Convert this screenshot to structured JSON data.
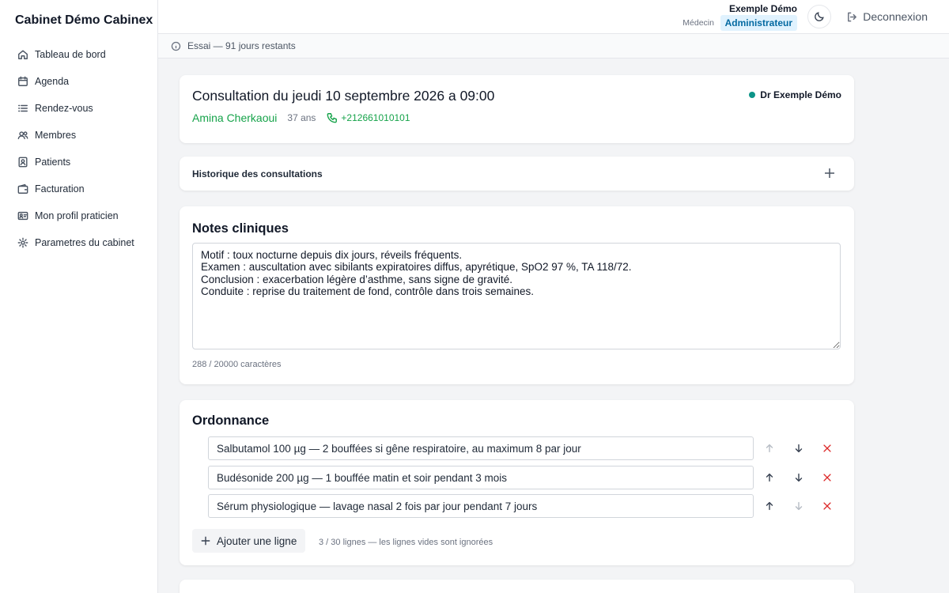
{
  "app": {
    "title": "Cabinet Démo Cabinex"
  },
  "sidebar": {
    "items": [
      {
        "label": "Tableau de bord",
        "icon": "home-icon"
      },
      {
        "label": "Agenda",
        "icon": "calendar-icon"
      },
      {
        "label": "Rendez-vous",
        "icon": "list-icon"
      },
      {
        "label": "Membres",
        "icon": "users-icon"
      },
      {
        "label": "Patients",
        "icon": "contact-icon"
      },
      {
        "label": "Facturation",
        "icon": "wallet-icon"
      },
      {
        "label": "Mon profil praticien",
        "icon": "id-card-icon"
      },
      {
        "label": "Parametres du cabinet",
        "icon": "gear-icon"
      }
    ]
  },
  "header": {
    "user_name": "Exemple Démo",
    "user_role": "Médecin",
    "user_badge": "Administrateur",
    "logout_label": "Deconnexion"
  },
  "trial": {
    "text": "Essai — 91 jours restants"
  },
  "consultation": {
    "title": "Consultation du jeudi 10 septembre 2026 a 09:00",
    "patient_name": "Amina Cherkaoui",
    "patient_age": "37 ans",
    "patient_phone": "+212661010101",
    "doctor": "Dr Exemple Démo",
    "doctor_status_color": "#0d9488"
  },
  "history": {
    "title": "Historique des consultations"
  },
  "notes": {
    "title": "Notes cliniques",
    "text": "Motif : toux nocturne depuis dix jours, réveils fréquents.\nExamen : auscultation avec sibilants expiratoires diffus, apyrétique, SpO2 97 %, TA 118/72.\nConclusion : exacerbation légère d’asthme, sans signe de gravité.\nConduite : reprise du traitement de fond, contrôle dans trois semaines.",
    "count": "288 / 20000 caractères"
  },
  "prescription": {
    "title": "Ordonnance",
    "lines": [
      {
        "value": "Salbutamol 100 µg — 2 bouffées si gêne respiratoire, au maximum 8 par jour"
      },
      {
        "value": "Budésonide 200 µg — 1 bouffée matin et soir pendant 3 mois"
      },
      {
        "value": "Sérum physiologique — lavage nasal 2 fois par jour pendant 7 jours"
      }
    ],
    "add_label": "Ajouter une ligne",
    "count": "3 / 30 lignes — les lignes vides sont ignorées"
  },
  "colors": {
    "accent_green": "#16a34a",
    "badge_bg": "#e0f2fe",
    "badge_text": "#0369a1",
    "delete_red": "#dc2626"
  }
}
